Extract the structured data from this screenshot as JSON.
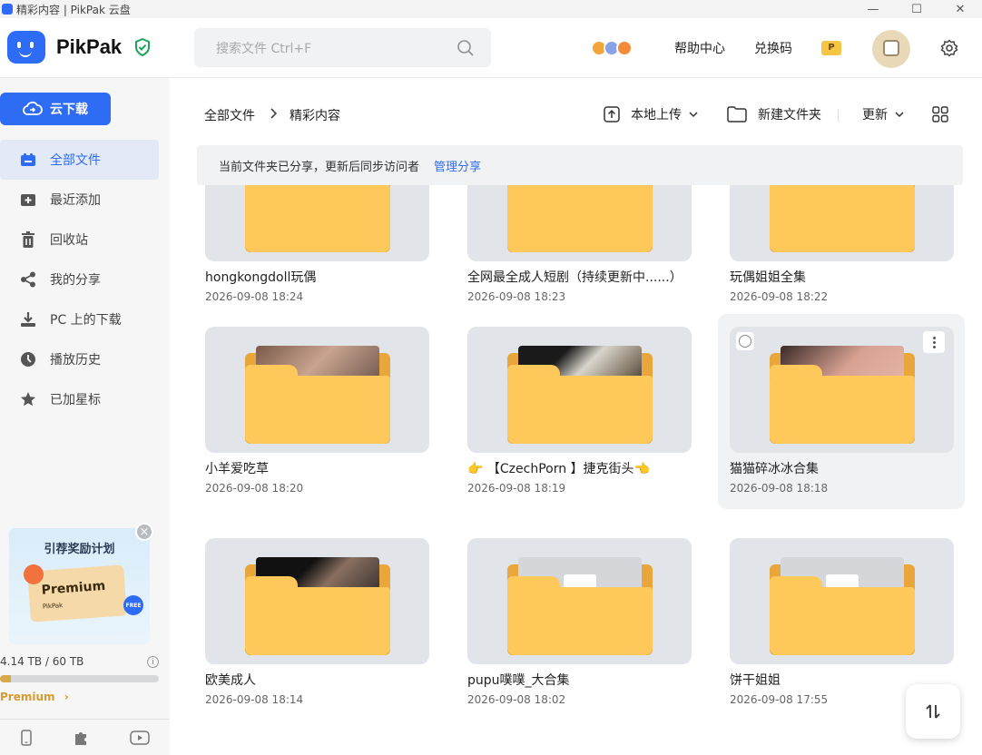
{
  "window": {
    "title": "精彩内容 | PikPak 云盘",
    "controls": [
      "—",
      "☐",
      "✕"
    ]
  },
  "header": {
    "brand": "PikPak",
    "search_placeholder": "搜索文件 Ctrl+F",
    "help": "帮助中心",
    "redeem": "兑换码",
    "p_badge": "P"
  },
  "sidebar": {
    "cloud_download": "云下载",
    "items": [
      {
        "label": "全部文件",
        "icon": "folder-icon"
      },
      {
        "label": "最近添加",
        "icon": "add-folder-icon"
      },
      {
        "label": "回收站",
        "icon": "trash-icon"
      },
      {
        "label": "我的分享",
        "icon": "share-icon"
      },
      {
        "label": "PC 上的下载",
        "icon": "download-icon"
      },
      {
        "label": "播放历史",
        "icon": "history-icon"
      },
      {
        "label": "已加星标",
        "icon": "star-icon"
      }
    ],
    "promo": {
      "title": "引荐奖励计划",
      "card_label": "Premium",
      "card_brand": "PikPak",
      "free_badge": "FREE"
    },
    "storage": {
      "text": "4.14 TB / 60 TB",
      "used_fraction": 0.069
    },
    "premium_link": "Premium"
  },
  "main": {
    "breadcrumb": [
      "全部文件",
      "精彩内容"
    ],
    "toolbar": {
      "upload": "本地上传",
      "new_folder": "新建文件夹",
      "sort": "更新"
    },
    "notice": {
      "text": "当前文件夹已分享，更新后同步访问者",
      "link": "管理分享"
    },
    "files": [
      {
        "name": "hongkongdoll玩偶",
        "date": "2026-09-08 18:24",
        "thumb": "none"
      },
      {
        "name": "全网最全成人短剧（持续更新中......）",
        "date": "2026-09-08 18:23",
        "thumb": "none"
      },
      {
        "name": "玩偶姐姐全集",
        "date": "2026-09-08 18:22",
        "thumb": "none"
      },
      {
        "name": "小羊爱吃草",
        "date": "2026-09-08 18:20",
        "thumb": "photo"
      },
      {
        "name": "👉 【CzechPorn 】捷克街头👈",
        "date": "2026-09-08 18:19",
        "thumb": "photo"
      },
      {
        "name": "猫猫碎冰冰合集",
        "date": "2026-09-08 18:18",
        "thumb": "photo"
      },
      {
        "name": "欧美成人",
        "date": "2026-09-08 18:14",
        "thumb": "photo"
      },
      {
        "name": "pupu噗噗_大合集",
        "date": "2026-09-08 18:02",
        "thumb": "doc"
      },
      {
        "name": "饼干姐姐",
        "date": "2026-09-08 17:55",
        "thumb": "doc"
      }
    ]
  },
  "colors": {
    "accent": "#2e6cf6",
    "folder": "#ffc85a",
    "premium": "#d59a30"
  }
}
